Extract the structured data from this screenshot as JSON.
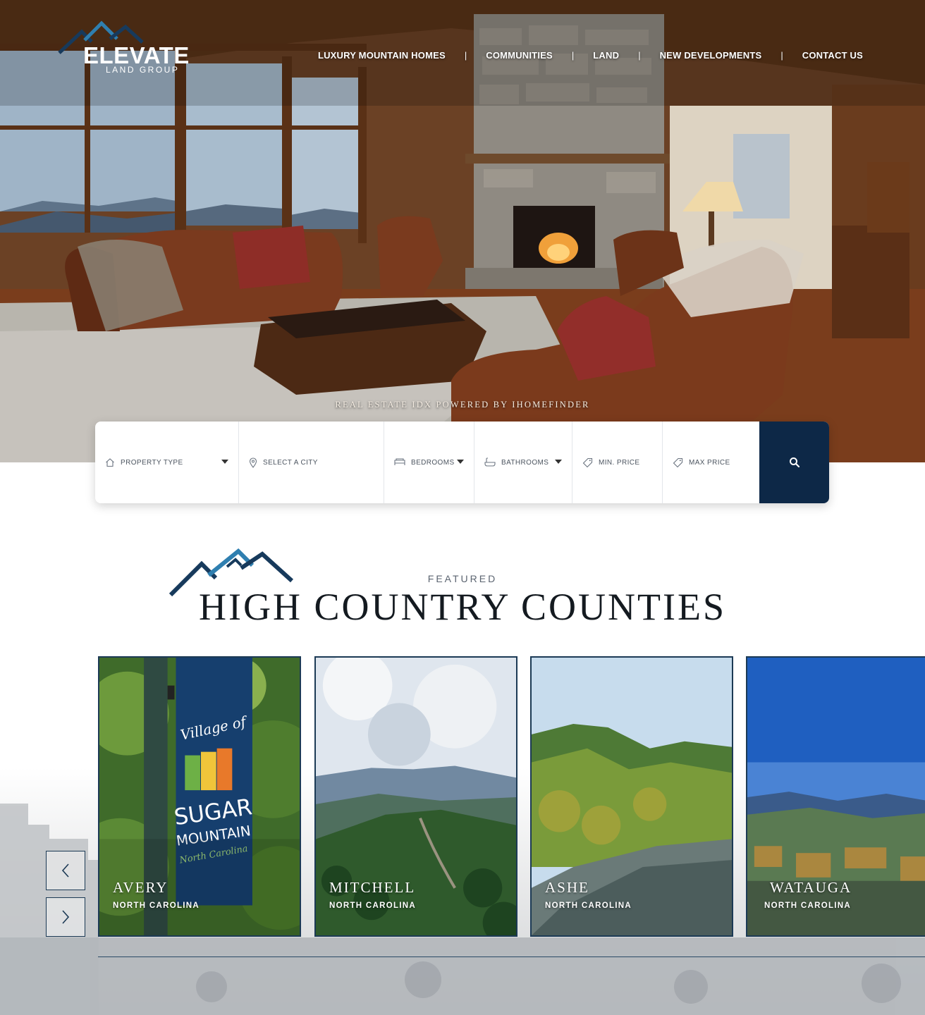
{
  "brand": {
    "name": "ELEVATE",
    "tagline": "LAND GROUP"
  },
  "nav": {
    "items": [
      {
        "label": "LUXURY MOUNTAIN HOMES"
      },
      {
        "label": "COMMUNITIES"
      },
      {
        "label": "LAND"
      },
      {
        "label": "NEW DEVELOPMENTS"
      },
      {
        "label": "CONTACT US"
      }
    ],
    "separator": "|"
  },
  "hero": {
    "credit": "REAL ESTATE IDX POWERED BY IHOMEFINDER"
  },
  "search": {
    "property_type": "PROPERTY TYPE",
    "city": "SELECT A CITY",
    "bedrooms": "BEDROOMS",
    "bathrooms": "BATHROOMS",
    "min_price": "MIN. PRICE",
    "max_price": "MAX PRICE"
  },
  "featured": {
    "label": "FEATURED",
    "title": "HIGH COUNTRY COUNTIES"
  },
  "counties": [
    {
      "name": "AVERY",
      "state": "NORTH CAROLINA"
    },
    {
      "name": "MITCHELL",
      "state": "NORTH CAROLINA"
    },
    {
      "name": "ASHE",
      "state": "NORTH CAROLINA"
    },
    {
      "name": "WATAUGA",
      "state": "NORTH CAROLINA"
    }
  ],
  "banner_text": {
    "line1": "Village of",
    "line2": "SUGAR",
    "line3": "MOUNTAIN",
    "line4": "North Carolina"
  },
  "colors": {
    "navy": "#0d2847",
    "border": "#1c3a55",
    "logo_blue": "#2f7fb0"
  }
}
